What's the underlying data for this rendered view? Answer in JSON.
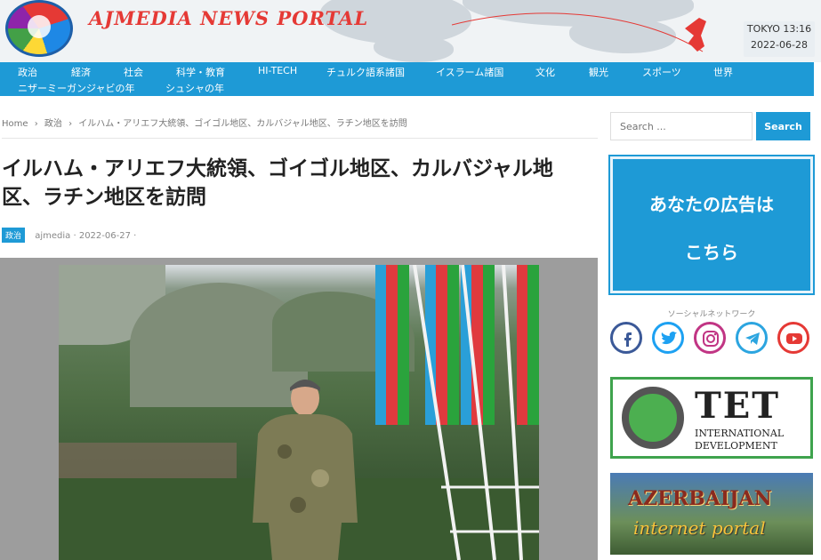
{
  "header": {
    "site_title": "AJMEDIA NEWS PORTAL",
    "city_time": "TOKYO 13:16",
    "date": "2022-06-28"
  },
  "nav": {
    "row1": [
      "政治",
      "経済",
      "社会",
      "科学・教育",
      "HI-TECH",
      "チュルク語系諸国",
      "イスラーム諸国",
      "文化",
      "観光",
      "スポーツ",
      "世界"
    ],
    "row2": [
      "ニザーミーガンジャビの年",
      "シュシャの年"
    ]
  },
  "breadcrumb": {
    "home": "Home",
    "sep": "›",
    "category": "政治",
    "current": "イルハム・アリエフ大統領、ゴイゴル地区、カルバジャル地区、ラチン地区を訪問"
  },
  "article": {
    "title": "イルハム・アリエフ大統領、ゴイゴル地区、カルバジャル地区、ラチン地区を訪問",
    "category": "政治",
    "author": "ajmedia",
    "date": "2022-06-27",
    "sep": "·"
  },
  "sidebar": {
    "search_placeholder": "Search ...",
    "search_button": "Search",
    "ad_line1": "あなたの広告は",
    "ad_line2": "こちら",
    "social_label": "ソーシャルネットワーク",
    "social_icons": [
      "facebook-icon",
      "twitter-icon",
      "instagram-icon",
      "telegram-icon",
      "youtube-icon"
    ],
    "tet_big": "TET",
    "tet_line1": "INTERNATIONAL",
    "tet_line2": "DEVELOPMENT",
    "aze_title": "AZERBAIJAN",
    "aze_sub": "internet portal"
  },
  "colors": {
    "accent": "#1e9ad6",
    "title_red": "#e53935",
    "tet_green": "#3fa34d"
  }
}
